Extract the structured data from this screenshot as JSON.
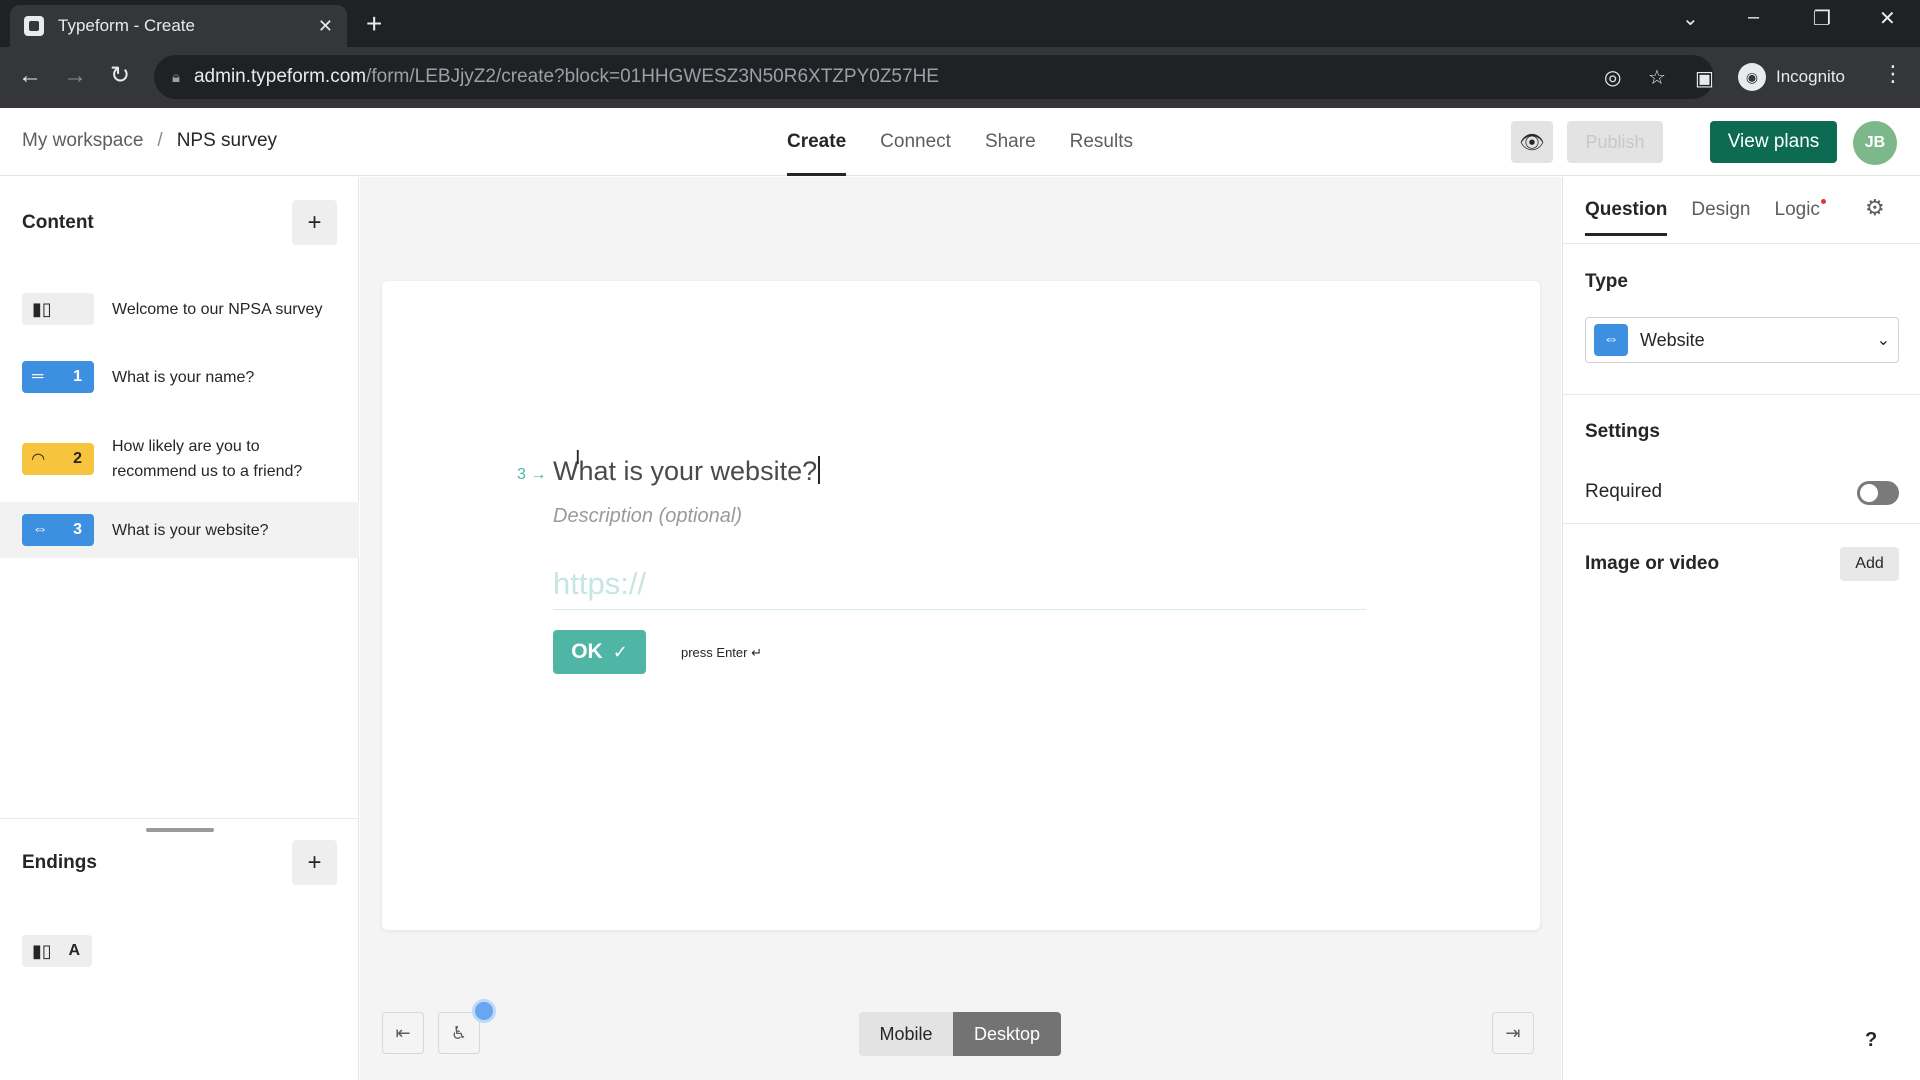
{
  "browser": {
    "tab_title": "Typeform - Create",
    "url_host": "admin.typeform.com",
    "url_path": "/form/LEBJjyZ2/create?block=01HHGWESZ3N50R6XTZPY0Z57HE",
    "profile_label": "Incognito"
  },
  "header": {
    "breadcrumb_workspace": "My workspace",
    "breadcrumb_separator": "/",
    "breadcrumb_form": "NPS survey",
    "nav": [
      "Create",
      "Connect",
      "Share",
      "Results"
    ],
    "publish_label": "Publish",
    "view_plans_label": "View plans",
    "avatar_initials": "JB"
  },
  "sidebar": {
    "content_title": "Content",
    "items": [
      {
        "number": "",
        "label": "Welcome to our NPSA survey",
        "color": "#eeeeee",
        "icon": "welcome-screen-icon"
      },
      {
        "number": "1",
        "label": "What is your name?",
        "color": "#3d8fe0",
        "icon": "short-text-icon"
      },
      {
        "number": "2",
        "label": "How likely are you to recommend us to a friend?",
        "color": "#f7c43d",
        "icon": "gauge-icon"
      },
      {
        "number": "3",
        "label": "What is your website?",
        "color": "#3d8fe0",
        "icon": "link-icon"
      }
    ],
    "endings_title": "Endings",
    "ending_item": {
      "letter": "A",
      "icon": "ending-screen-icon"
    }
  },
  "canvas": {
    "question_number": "3",
    "question_title": "What is your website?",
    "description_placeholder": "Description (optional)",
    "answer_placeholder": "https://",
    "ok_label": "OK",
    "press_enter": "press Enter ↵",
    "view_mobile": "Mobile",
    "view_desktop": "Desktop"
  },
  "panel": {
    "tabs": [
      "Question",
      "Design",
      "Logic"
    ],
    "type_label": "Type",
    "type_value": "Website",
    "settings_label": "Settings",
    "required_label": "Required",
    "required_on": false,
    "media_label": "Image or video",
    "add_label": "Add",
    "help_label": "?"
  }
}
